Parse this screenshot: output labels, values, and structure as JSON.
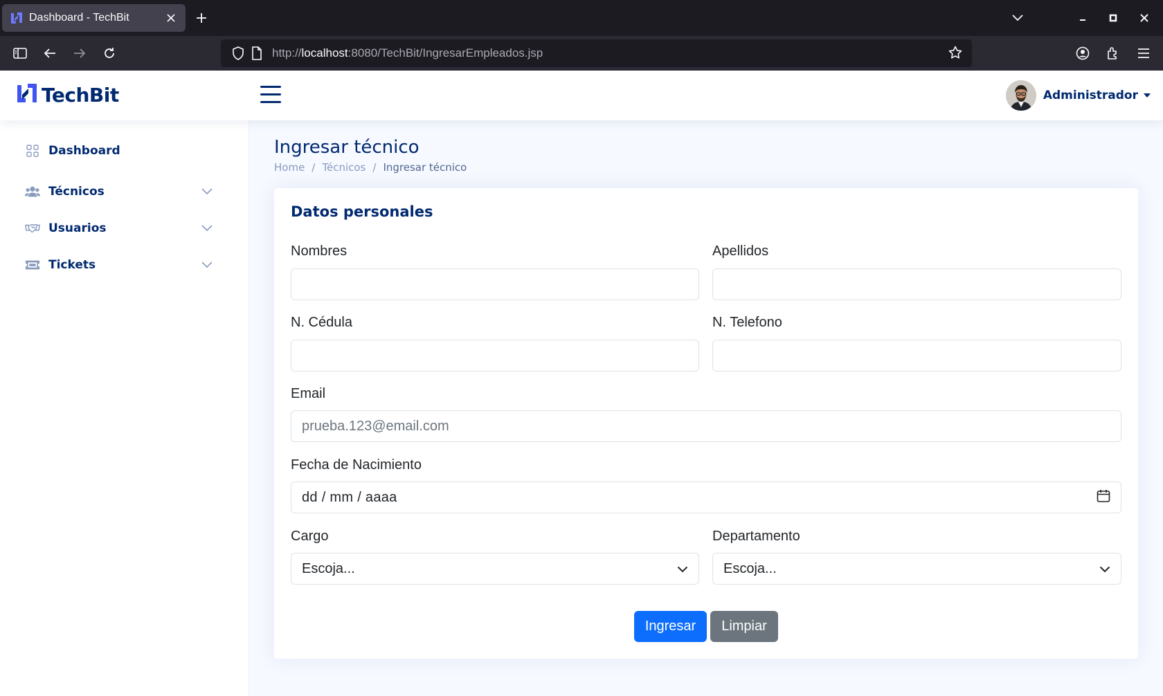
{
  "browser": {
    "tab_title": "Dashboard - TechBit",
    "url_prefix": "http://",
    "url_host": "localhost",
    "url_rest": ":8080/TechBit/IngresarEmpleados.jsp"
  },
  "header": {
    "brand": "TechBit",
    "user_name": "Administrador"
  },
  "sidebar": {
    "items": [
      {
        "label": "Dashboard",
        "icon": "grid-icon"
      },
      {
        "label": "Técnicos",
        "icon": "people-icon"
      },
      {
        "label": "Usuarios",
        "icon": "handshake-icon"
      },
      {
        "label": "Tickets",
        "icon": "ticket-icon"
      }
    ]
  },
  "page": {
    "title": "Ingresar técnico",
    "breadcrumb": [
      "Home",
      "Técnicos",
      "Ingresar técnico"
    ]
  },
  "form": {
    "section_title": "Datos personales",
    "nombres_label": "Nombres",
    "nombres_value": "",
    "apellidos_label": "Apellidos",
    "apellidos_value": "",
    "cedula_label": "N. Cédula",
    "cedula_value": "",
    "telefono_label": "N. Telefono",
    "telefono_value": "",
    "email_label": "Email",
    "email_placeholder": "prueba.123@email.com",
    "fecha_label": "Fecha de Nacimiento",
    "fecha_placeholder": "dd / mm / aaaa",
    "cargo_label": "Cargo",
    "cargo_value": "Escoja...",
    "departamento_label": "Departamento",
    "departamento_value": "Escoja...",
    "submit_label": "Ingresar",
    "reset_label": "Limpiar"
  },
  "colors": {
    "brand": "#012970",
    "primary": "#0d6efd",
    "secondary": "#6c757d",
    "logo_accent": "#4154f1"
  }
}
